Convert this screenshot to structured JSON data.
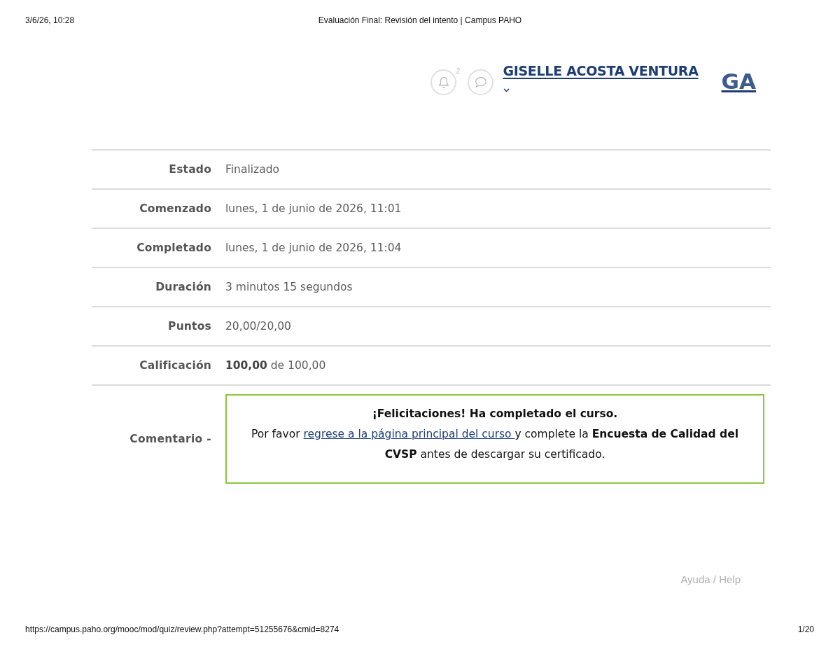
{
  "print_header": {
    "date": "3/6/26, 10:28",
    "title": "Evaluación Final: Revisión del intento | Campus PAHO"
  },
  "navbar": {
    "notification_count": "2",
    "user_name": "GISELLE ACOSTA VENTURA",
    "initials": "GA"
  },
  "summary": {
    "rows": [
      {
        "label": "Estado",
        "value": "Finalizado"
      },
      {
        "label": "Comenzado",
        "value": "lunes, 1 de junio de 2026, 11:01"
      },
      {
        "label": "Completado",
        "value": "lunes, 1 de junio de 2026, 11:04"
      },
      {
        "label": "Duración",
        "value": "3 minutos 15 segundos"
      },
      {
        "label": "Puntos",
        "value": "20,00/20,00"
      },
      {
        "label": "Calificación",
        "value": "**100,00** de 100,00"
      }
    ]
  },
  "comment": {
    "label": "Comentario -",
    "heading": "¡Felicitaciones! Ha completado el curso.",
    "text_before": "Por favor ",
    "link": "regrese a la página principal del curso ",
    "text_after": "y complete la **Encuesta de Calidad del CVSP** antes de descargar su certificado."
  },
  "help_link": "Ayuda / Help",
  "print_footer": {
    "url": "https://campus.paho.org/mooc/mod/quiz/review.php?attempt=51255676&cmid=8274",
    "page": "1/20"
  }
}
